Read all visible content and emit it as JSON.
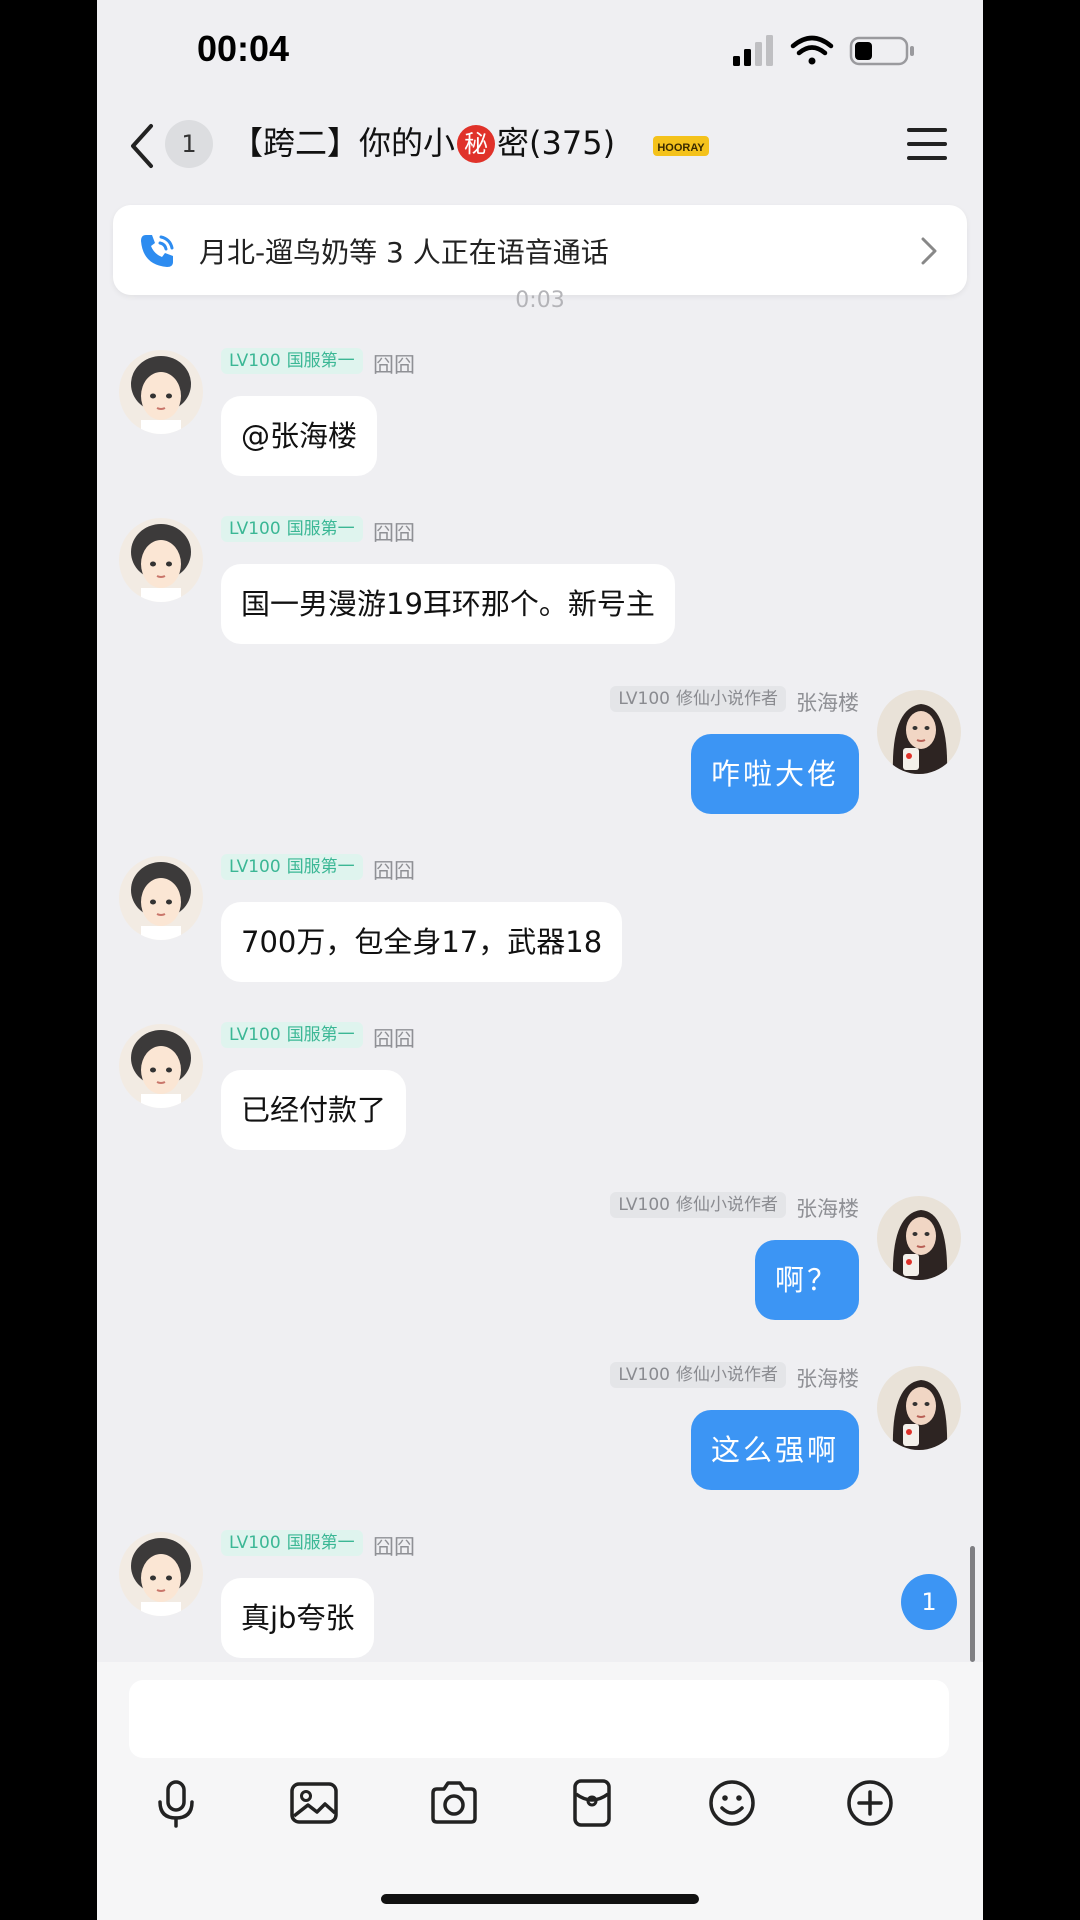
{
  "status_bar": {
    "time": "00:04"
  },
  "header": {
    "unread_count": "1",
    "title_prefix": "【跨二】你的小",
    "title_badge": "秘",
    "title_suffix": "密(375)",
    "badge_text": "HOORAY"
  },
  "call_banner": {
    "text": "月北-遛鸟奶等 3 人正在语音通话",
    "duration": "0:03"
  },
  "messages": [
    {
      "side": "in",
      "level": "LV100",
      "title": "国服第一",
      "name": "囧囧",
      "text": "@张海楼"
    },
    {
      "side": "in",
      "level": "LV100",
      "title": "国服第一",
      "name": "囧囧",
      "text": "国一男漫游19耳环那个。新号主"
    },
    {
      "side": "out",
      "level": "LV100",
      "title": "修仙小说作者",
      "name": "张海楼",
      "text": "咋啦大佬"
    },
    {
      "side": "in",
      "level": "LV100",
      "title": "国服第一",
      "name": "囧囧",
      "text": "700万，包全身17，武器18"
    },
    {
      "side": "in",
      "level": "LV100",
      "title": "国服第一",
      "name": "囧囧",
      "text": "已经付款了"
    },
    {
      "side": "out",
      "level": "LV100",
      "title": "修仙小说作者",
      "name": "张海楼",
      "text": "啊？"
    },
    {
      "side": "out",
      "level": "LV100",
      "title": "修仙小说作者",
      "name": "张海楼",
      "text": "这么强啊"
    },
    {
      "side": "in",
      "level": "LV100",
      "title": "国服第一",
      "name": "囧囧",
      "text": "真jb夸张"
    }
  ],
  "new_message_count": "1",
  "input": {
    "value": ""
  },
  "colors": {
    "accent": "#3c95f4",
    "level_green": "#3bb795",
    "secret_red": "#e0322a"
  },
  "toolbar_icons": [
    "microphone-icon",
    "image-icon",
    "camera-icon",
    "red-packet-icon",
    "emoji-icon",
    "plus-icon"
  ]
}
